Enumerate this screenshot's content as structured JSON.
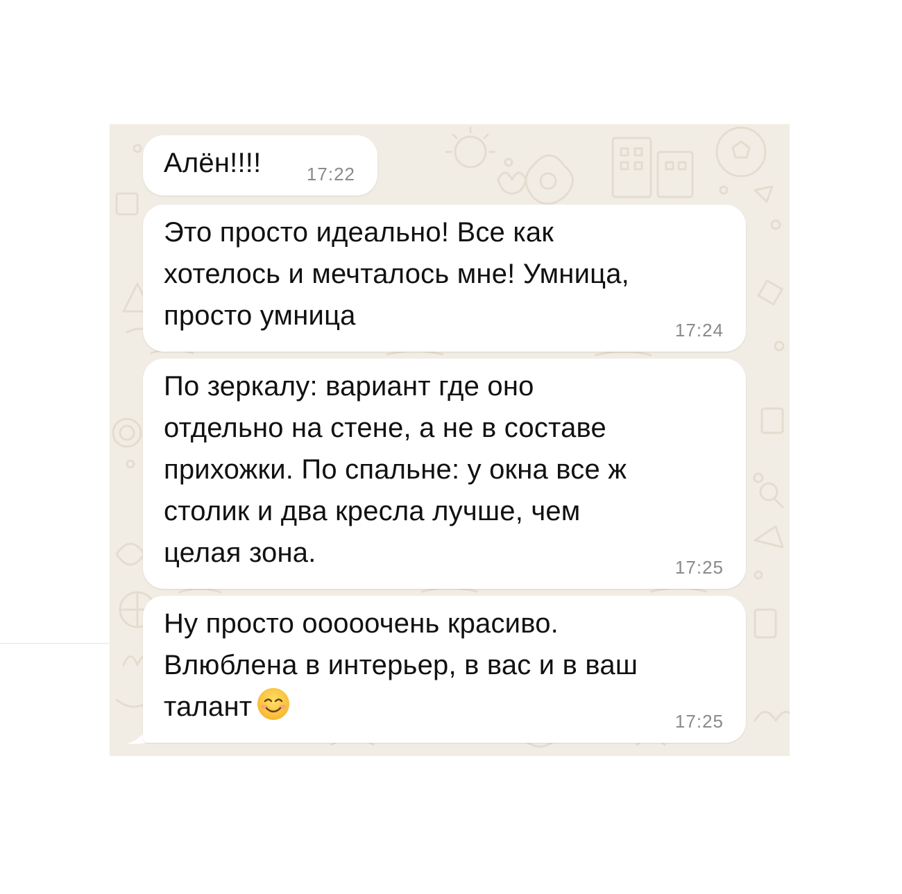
{
  "chat": {
    "messages": [
      {
        "text": "Алён!!!!",
        "time": "17:22"
      },
      {
        "text": "Это просто идеально! Все как\nхотелось и мечталось мне! Умница,\nпросто умница",
        "time": "17:24"
      },
      {
        "text": "По зеркалу: вариант где оно\nотдельно на стене, а не в составе\nприхожки. По спальне: у окна все ж\nстолик и два кресла лучше, чем\nцелая зона.",
        "time": "17:25"
      },
      {
        "text": "Ну просто ооооочень красиво.\nВлюблена в интерьер, в вас и в ваш\nталант",
        "time": "17:25",
        "emoji": "smiling-face-icon"
      }
    ]
  },
  "colors": {
    "chat_background": "#f2ede4",
    "bubble": "#ffffff",
    "text": "#111111",
    "timestamp": "#8a8a8a"
  }
}
